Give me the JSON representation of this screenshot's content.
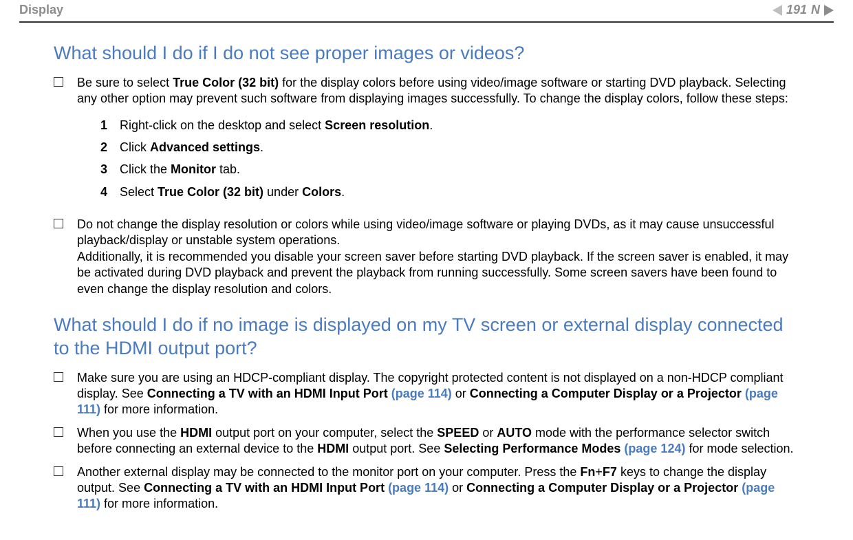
{
  "header": {
    "section": "Display",
    "page_number": "191",
    "letter": "N"
  },
  "q1": {
    "heading": "What should I do if I do not see proper images or videos?",
    "bullet1": {
      "pre": "Be sure to select ",
      "bold1": "True Color (32 bit)",
      "post": " for the display colors before using video/image software or starting DVD playback. Selecting any other option may prevent such software from displaying images successfully. To change the display colors, follow these steps:"
    },
    "steps": {
      "s1": {
        "n": "1",
        "pre": "Right-click on the desktop and select ",
        "b1": "Screen resolution",
        "post": "."
      },
      "s2": {
        "n": "2",
        "pre": "Click ",
        "b1": "Advanced settings",
        "post": "."
      },
      "s3": {
        "n": "3",
        "pre": "Click the ",
        "b1": "Monitor",
        "post": " tab."
      },
      "s4": {
        "n": "4",
        "pre": "Select ",
        "b1": "True Color (32 bit)",
        "mid": " under ",
        "b2": "Colors",
        "post": "."
      }
    },
    "bullet2": "Do not change the display resolution or colors while using video/image software or playing DVDs, as it may cause unsuccessful playback/display or unstable system operations.",
    "bullet2b": "Additionally, it is recommended you disable your screen saver before starting DVD playback. If the screen saver is enabled, it may be activated during DVD playback and prevent the playback from running successfully. Some screen savers have been found to even change the display resolution and colors."
  },
  "q2": {
    "heading": "What should I do if no image is displayed on my TV screen or external display connected to the HDMI output port?",
    "bullet1": {
      "pre": "Make sure you are using an HDCP-compliant display. The copyright protected content is not displayed on a non-HDCP compliant display. See ",
      "b1": "Connecting a TV with an HDMI Input Port ",
      "link1": "(page 114)",
      "mid": " or ",
      "b2": "Connecting a Computer Display or a Projector ",
      "link2": "(page 111)",
      "post": " for more information."
    },
    "bullet2": {
      "pre": "When you use the ",
      "b1": "HDMI",
      "t1": " output port on your computer, select the ",
      "b2": "SPEED",
      "t2": " or ",
      "b3": "AUTO",
      "t3": " mode with the performance selector switch before connecting an external device to the ",
      "b4": "HDMI",
      "t4": " output port. See ",
      "b5": "Selecting Performance Modes ",
      "link1": "(page 124)",
      "post": " for mode selection."
    },
    "bullet3": {
      "pre": "Another external display may be connected to the monitor port on your computer. Press the ",
      "b1": "Fn",
      "t1": "+",
      "b2": "F7",
      "t2": " keys to change the display output. See ",
      "b3": "Connecting a TV with an HDMI Input Port ",
      "link1": "(page 114)",
      "mid": " or ",
      "b4": "Connecting a Computer Display or a Projector ",
      "link2": "(page 111)",
      "post": " for more information."
    }
  }
}
